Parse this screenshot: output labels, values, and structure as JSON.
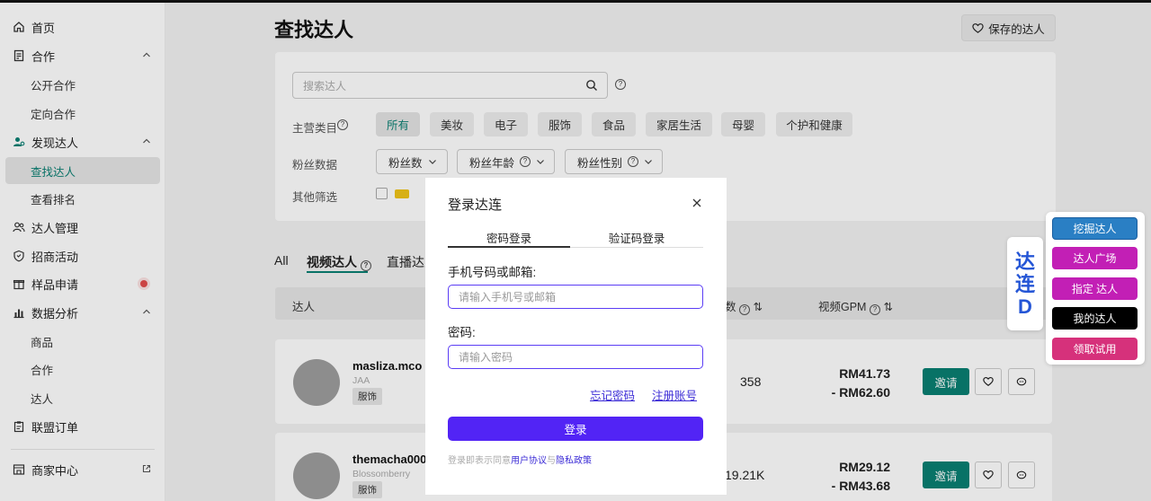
{
  "sidebar": {
    "items": [
      {
        "label": "首页",
        "icon": "home-icon"
      },
      {
        "label": "合作",
        "icon": "contract-icon"
      },
      {
        "label": "公开合作"
      },
      {
        "label": "定向合作"
      },
      {
        "label": "发现达人",
        "icon": "user-search-icon"
      },
      {
        "label": "查找达人"
      },
      {
        "label": "查看排名"
      },
      {
        "label": "达人管理",
        "icon": "users-icon"
      },
      {
        "label": "招商活动",
        "icon": "shield-icon"
      },
      {
        "label": "样品申请",
        "icon": "gift-icon"
      },
      {
        "label": "数据分析",
        "icon": "bar-chart-icon"
      },
      {
        "label": "商品"
      },
      {
        "label": "合作"
      },
      {
        "label": "达人"
      },
      {
        "label": "联盟订单",
        "icon": "clipboard-icon"
      },
      {
        "label": "商家中心",
        "icon": "store-icon"
      }
    ]
  },
  "header": {
    "title": "查找达人",
    "saved_label": "保存的达人"
  },
  "filters": {
    "search_placeholder": "搜索达人",
    "category_label": "主营类目",
    "categories": [
      "所有",
      "美妆",
      "电子",
      "服饰",
      "食品",
      "家居生活",
      "母婴",
      "个护和健康"
    ],
    "fans_label": "粉丝数据",
    "fans_dropdowns": [
      "粉丝数",
      "粉丝年龄",
      "粉丝性别"
    ],
    "other_label": "其他筛选"
  },
  "tabs": [
    "All",
    "视频达人",
    "直播达人"
  ],
  "list": {
    "headers": {
      "creator": "达人",
      "count_suffix": "数",
      "gpm": "视频GPM"
    },
    "rows": [
      {
        "name": "masliza.mco",
        "sub": "JAA",
        "tag": "服饰",
        "value": "358",
        "gpm_low": "RM41.73",
        "gpm_high": "- RM62.60",
        "invite": "邀请"
      },
      {
        "name": "themacha000",
        "sub": "Blossomberry",
        "tag": "服饰",
        "value": "19.21K",
        "gpm_low": "RM29.12",
        "gpm_high": "- RM43.68",
        "invite": "邀请"
      }
    ]
  },
  "extension": {
    "logo_chars": [
      "达",
      "连",
      "D"
    ],
    "buttons": [
      {
        "label": "挖掘达人",
        "color": "#2a7fc4"
      },
      {
        "label": "达人广场",
        "color": "#c21fb5"
      },
      {
        "label": "指定 达人",
        "color": "#c21fb5"
      },
      {
        "label": "我的达人",
        "color": "#000000"
      },
      {
        "label": "领取试用",
        "color": "#d6317b"
      }
    ]
  },
  "modal": {
    "title": "登录达连",
    "tabs": [
      "密码登录",
      "验证码登录"
    ],
    "phone_label": "手机号码或邮箱:",
    "phone_placeholder": "请输入手机号或邮箱",
    "password_label": "密码:",
    "password_placeholder": "请输入密码",
    "forgot": "忘记密码",
    "register": "注册账号",
    "login": "登录",
    "terms_prefix": "登录即表示同意",
    "terms_user": "用户协议",
    "terms_and": "与",
    "terms_privacy": "隐私政策"
  },
  "colors": {
    "accent": "#0a7f72",
    "modal_primary": "#5224f5"
  }
}
